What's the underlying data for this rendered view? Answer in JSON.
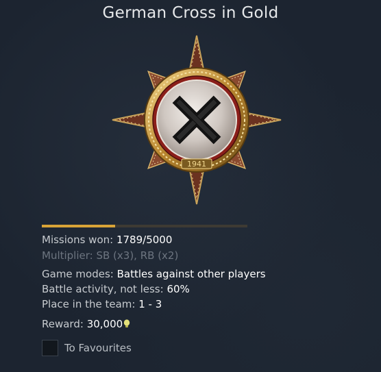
{
  "title": "German Cross in Gold",
  "medal": {
    "year": "1941",
    "icon": "medal-german-cross-icon"
  },
  "progress": {
    "fraction": 0.357
  },
  "missions": {
    "label": "Missions won:",
    "value": "1789/5000"
  },
  "multiplier": {
    "text": "Multiplier: SB (x3), RB (x2)"
  },
  "conditions": {
    "game_modes_label": "Game modes:",
    "game_modes_value": "Battles against other players",
    "activity_label": "Battle activity, not less:",
    "activity_value": "60%",
    "place_label": "Place in the team:",
    "place_value": "1 - 3"
  },
  "reward": {
    "label": "Reward:",
    "value": "30,000",
    "icon": "lion-currency-icon"
  },
  "favourites": {
    "label": "To Favourites",
    "checked": false
  },
  "colors": {
    "accent": "#d9a437",
    "background": "#1d2530"
  }
}
